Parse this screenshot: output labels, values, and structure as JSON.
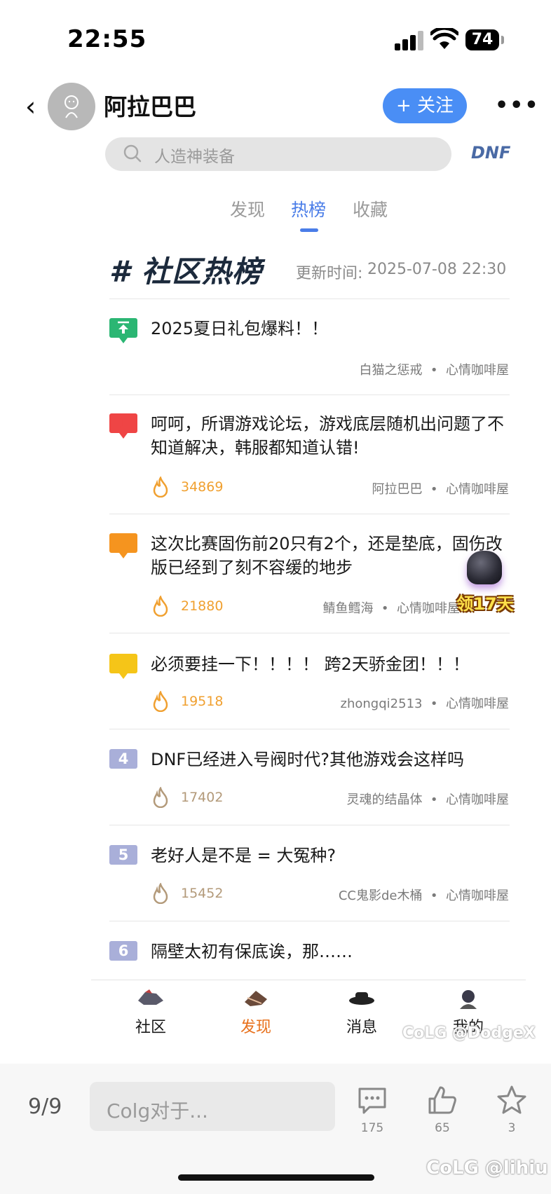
{
  "status_bar": {
    "time": "22:55",
    "battery": "74"
  },
  "header": {
    "back_icon": "chevron-left-icon",
    "username": "阿拉巴巴",
    "follow_label": "+ 关注",
    "more_icon": "more-horizontal-icon"
  },
  "search": {
    "placeholder": "人造神装备",
    "logo": "DNF"
  },
  "tabs": [
    {
      "label": "发现",
      "active": false
    },
    {
      "label": "热榜",
      "active": true
    },
    {
      "label": "收藏",
      "active": false
    }
  ],
  "board": {
    "title": "# 社区热榜",
    "update_label": "更新时间:",
    "update_time": "2025-07-08 22:30"
  },
  "items": [
    {
      "rank": "",
      "title": "2025夏日礼包爆料！！",
      "heat": "",
      "author": "白猫之惩戒",
      "forum": "心情咖啡屋"
    },
    {
      "rank": "1",
      "title": "呵呵，所谓游戏论坛，游戏底层随机出问题了不知道解决，韩服都知道认错!",
      "heat": "34869",
      "author": "阿拉巴巴",
      "forum": "心情咖啡屋"
    },
    {
      "rank": "2",
      "title": "这次比赛固伤前20只有2个，还是垫底，固伤改版已经到了刻不容缓的地步",
      "heat": "21880",
      "author": "鲭鱼鳕海",
      "forum": "心情咖啡屋"
    },
    {
      "rank": "3",
      "title": "必须要挂一下！！！！ 跨2天骄金团！！！",
      "heat": "19518",
      "author": "zhongqi2513",
      "forum": "心情咖啡屋"
    },
    {
      "rank": "4",
      "title": "DNF已经进入号阀时代?其他游戏会这样吗",
      "heat": "17402",
      "author": "灵魂的结晶体",
      "forum": "心情咖啡屋"
    },
    {
      "rank": "5",
      "title": "老好人是不是 = 大冤种?",
      "heat": "15452",
      "author": "CC鬼影de木桶",
      "forum": "心情咖啡屋"
    },
    {
      "rank": "6",
      "title": "隔壁太初有保底诶，那……",
      "heat": "",
      "author": "",
      "forum": ""
    }
  ],
  "promo": {
    "label": "领17天"
  },
  "inner_nav": [
    {
      "label": "社区",
      "icon": "community-icon",
      "active": false
    },
    {
      "label": "发现",
      "icon": "discover-icon",
      "active": true
    },
    {
      "label": "消息",
      "icon": "message-icon",
      "active": false
    },
    {
      "label": "我的",
      "icon": "profile-icon",
      "active": false
    }
  ],
  "watermarks": {
    "inner": "CoLG @DodgeX",
    "outer": "CoLG @lihiu"
  },
  "bottom_bar": {
    "page_indicator": "9/9",
    "comment_placeholder": "Colg对于...",
    "comments_count": "175",
    "likes_count": "65",
    "favorites_count": "3"
  },
  "colors": {
    "accent": "#4a8ef5",
    "rank1": "#ef4545",
    "rank2": "#f5941f",
    "rank3": "#f5c518",
    "rank_other": "#a9afd9",
    "pinned": "#2bb673",
    "heat_hot": "#f0a030",
    "heat_warm": "#b39a7a",
    "nav_active": "#e8711c"
  }
}
